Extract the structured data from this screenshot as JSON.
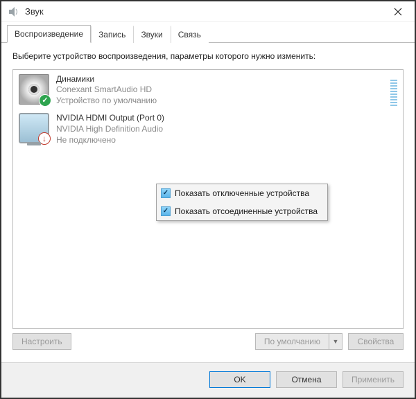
{
  "title": "Звук",
  "tabs": [
    {
      "label": "Воспроизведение",
      "active": true
    },
    {
      "label": "Запись",
      "active": false
    },
    {
      "label": "Звуки",
      "active": false
    },
    {
      "label": "Связь",
      "active": false
    }
  ],
  "instruction": "Выберите устройство воспроизведения, параметры которого нужно изменить:",
  "devices": [
    {
      "name": "Динамики",
      "desc": "Conexant SmartAudio HD",
      "status": "Устройство по умолчанию"
    },
    {
      "name": "NVIDIA HDMI Output (Port 0)",
      "desc": "NVIDIA High Definition Audio",
      "status": "Не подключено"
    }
  ],
  "context_menu": {
    "items": [
      {
        "checked": true,
        "label": "Показать отключенные устройства"
      },
      {
        "checked": true,
        "label": "Показать отсоединенные устройства"
      }
    ]
  },
  "buttons": {
    "configure": "Настроить",
    "set_default": "По умолчанию",
    "properties": "Свойства",
    "ok": "OK",
    "cancel": "Отмена",
    "apply": "Применить"
  }
}
